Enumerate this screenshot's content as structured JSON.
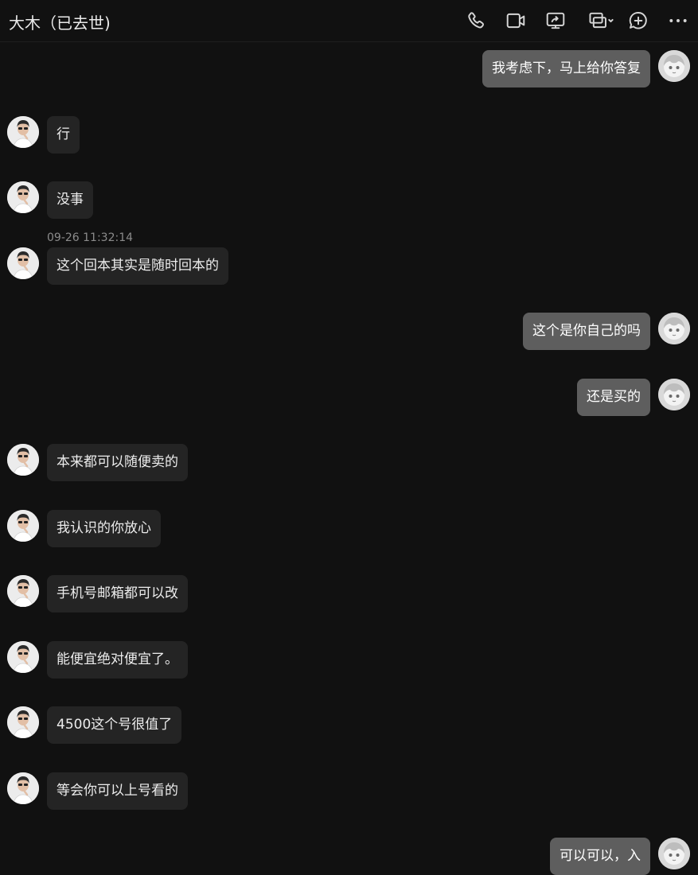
{
  "header": {
    "title": "大木（已去世)",
    "icons": [
      "phone-icon",
      "video-call-icon",
      "screen-share-icon",
      "remote-assist-icon",
      "add-icon",
      "more-icon"
    ]
  },
  "messages": [
    {
      "side": "right",
      "text": "我考虑下，马上给你答复"
    },
    {
      "side": "left",
      "text": "行"
    },
    {
      "side": "left",
      "text": "没事"
    },
    {
      "side": "left",
      "text": "这个回本其实是随时回本的",
      "timestamp": "09-26 11:32:14"
    },
    {
      "side": "right",
      "text": "这个是你自己的吗"
    },
    {
      "side": "right",
      "text": "还是买的"
    },
    {
      "side": "left",
      "text": "本来都可以随便卖的"
    },
    {
      "side": "left",
      "text": "我认识的你放心"
    },
    {
      "side": "left",
      "text": "手机号邮箱都可以改"
    },
    {
      "side": "left",
      "text": "能便宜绝对便宜了。"
    },
    {
      "side": "left",
      "text": "4500这个号很值了"
    },
    {
      "side": "left",
      "text": "等会你可以上号看的"
    },
    {
      "side": "right",
      "text": "可以可以，入"
    }
  ],
  "colors": {
    "background": "#111111",
    "bubble_left": "#242424",
    "bubble_right": "#5e5e5e"
  }
}
